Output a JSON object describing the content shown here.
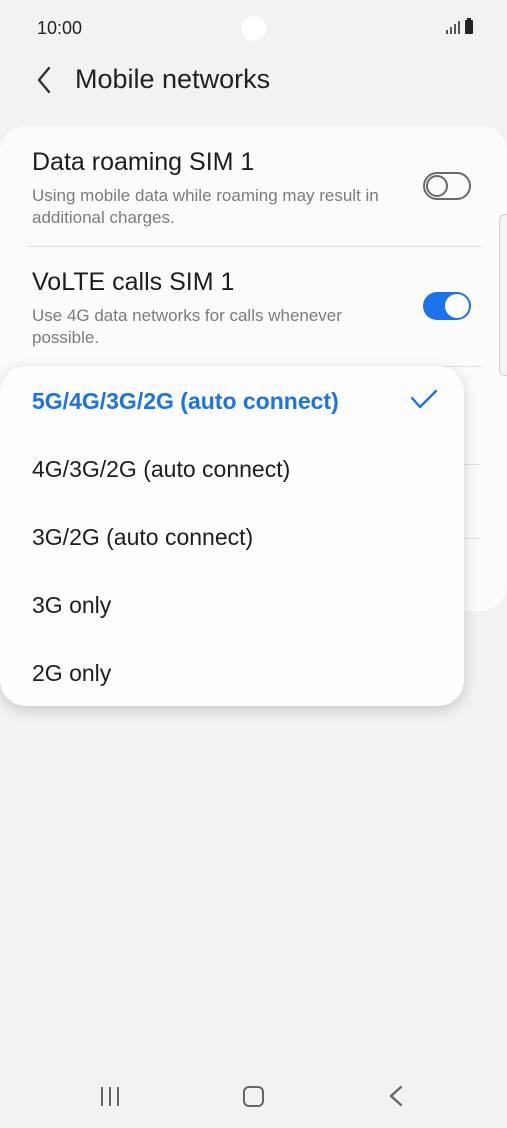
{
  "status": {
    "time": "10:00"
  },
  "header": {
    "title": "Mobile networks"
  },
  "settings": [
    {
      "title": "Data roaming SIM 1",
      "description": "Using mobile data while roaming may result in additional charges.",
      "toggle": "off"
    },
    {
      "title": "VoLTE calls SIM 1",
      "description": "Use 4G data networks for calls whenever possible.",
      "toggle": "on"
    }
  ],
  "network_mode_menu": {
    "options": [
      "5G/4G/3G/2G (auto connect)",
      "4G/3G/2G (auto connect)",
      "3G/2G (auto connect)",
      "3G only",
      "2G only"
    ],
    "selected": "5G/4G/3G/2G (auto connect)"
  },
  "colors": {
    "accent": "#1a73e8",
    "background": "#f2f2f2",
    "card": "#fbfbfb"
  },
  "icons": [
    "back-arrow-icon",
    "check-icon",
    "signal-icon",
    "battery-icon",
    "nav-recents-icon",
    "nav-home-icon",
    "nav-back-icon"
  ]
}
